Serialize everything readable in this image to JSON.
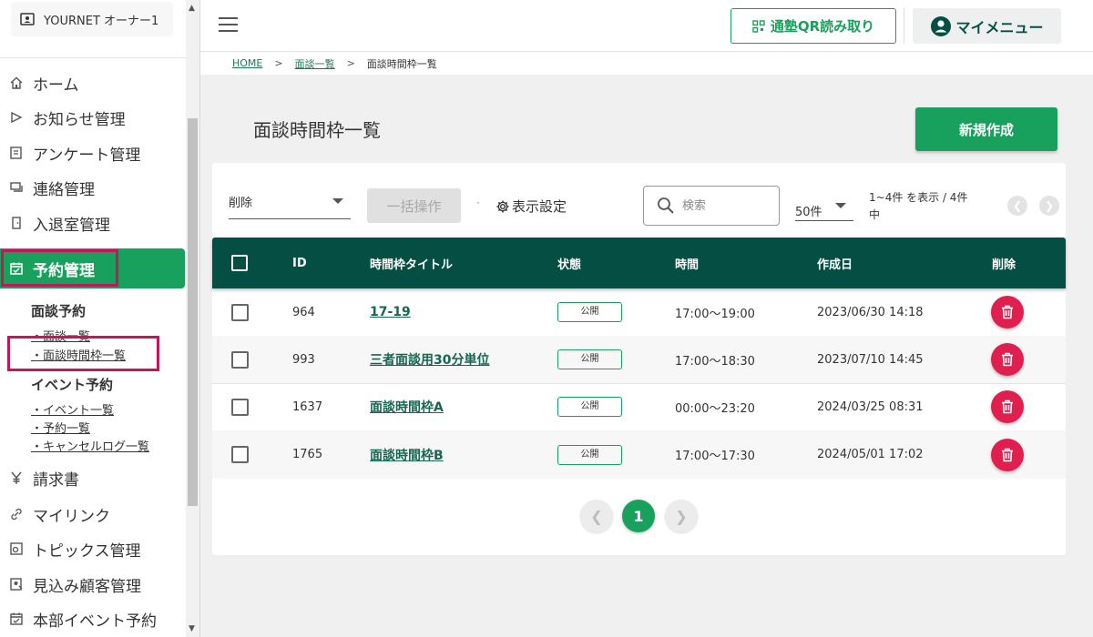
{
  "sidebar": {
    "account_name": "YOURNET オーナー1",
    "items": [
      {
        "label": "ホーム",
        "icon": "home-icon"
      },
      {
        "label": "お知らせ管理",
        "icon": "send-icon"
      },
      {
        "label": "アンケート管理",
        "icon": "survey-icon"
      },
      {
        "label": "連絡管理",
        "icon": "message-icon"
      },
      {
        "label": "入退室管理",
        "icon": "door-icon"
      },
      {
        "label": "予約管理",
        "icon": "calendar-check-icon",
        "active": true
      },
      {
        "label": "請求書",
        "icon": "yen-icon"
      },
      {
        "label": "マイリンク",
        "icon": "link-icon"
      },
      {
        "label": "トピックス管理",
        "icon": "topics-icon"
      },
      {
        "label": "見込み顧客管理",
        "icon": "prospect-icon"
      },
      {
        "label": "本部イベント予約",
        "icon": "calendar-icon"
      }
    ],
    "submenu": {
      "group1": "面談予約",
      "group1_links": [
        "・面談一覧",
        "・面談時間枠一覧"
      ],
      "group2": "イベント予約",
      "group2_links": [
        "・イベント一覧",
        "・予約一覧",
        "・キャンセルログ一覧"
      ]
    }
  },
  "header": {
    "qr_button": "通塾QR読み取り",
    "my_menu": "マイメニュー"
  },
  "breadcrumb": {
    "home": "HOME",
    "sep": ">",
    "list": "面談一覧",
    "current": "面談時間枠一覧"
  },
  "page": {
    "title": "面談時間枠一覧",
    "new_button": "新規作成"
  },
  "toolbar": {
    "bulk_select_value": "削除",
    "bulk_button": "一括操作",
    "dot": "·",
    "display_settings": "表示設定",
    "search_placeholder": "検索",
    "per_page": "50件",
    "range_info": "1~4件 を表示 / 4件中"
  },
  "table": {
    "headers": {
      "id": "ID",
      "title": "時間枠タイトル",
      "status": "状態",
      "time": "時間",
      "created": "作成日",
      "delete": "削除"
    },
    "rows": [
      {
        "id": "964",
        "title": "17-19",
        "status": "公開",
        "time": "17:00〜19:00",
        "created": "2023/06/30 14:18"
      },
      {
        "id": "993",
        "title": "三者面談用30分単位",
        "status": "公開",
        "time": "17:00〜18:30",
        "created": "2023/07/10 14:45"
      },
      {
        "id": "1637",
        "title": "面談時間枠A",
        "status": "公開",
        "time": "00:00〜23:20",
        "created": "2024/03/25 08:31"
      },
      {
        "id": "1765",
        "title": "面談時間枠B",
        "status": "公開",
        "time": "17:00〜17:30",
        "created": "2024/05/01 17:02"
      }
    ]
  },
  "pagination": {
    "current_page": "1"
  },
  "colors": {
    "primary": "#18a15c",
    "header_dark": "#044e44",
    "danger": "#e01f4f",
    "highlight": "#c2185b"
  }
}
